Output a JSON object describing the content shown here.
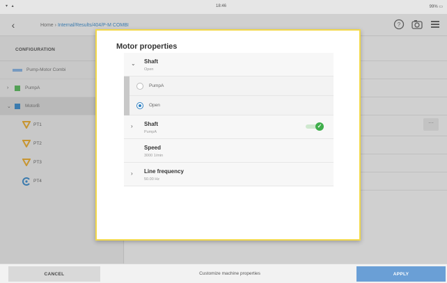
{
  "status": {
    "time": "18:46",
    "battery": "99%"
  },
  "header": {
    "home": "Home",
    "sep1": "›",
    "path": "Internal/Results/404/P-M COMBI"
  },
  "sidebar": {
    "title": "CONFIGURATION",
    "machine": "Pump-Motor Combi",
    "pump": "PumpA",
    "motor": "MotorB",
    "points": [
      "PT1",
      "PT2",
      "PT3",
      "PT4"
    ]
  },
  "dialog": {
    "title": "Motor properties",
    "shaft1": {
      "label": "Shaft",
      "value": "Open"
    },
    "options": [
      "PumpA",
      "Open"
    ],
    "shaft2": {
      "label": "Shaft",
      "value": "PumpA"
    },
    "speed": {
      "label": "Speed",
      "value": "3000 1/min"
    },
    "line": {
      "label": "Line frequency",
      "value": "50.00 Hz"
    }
  },
  "bottom": {
    "cancel": "CANCEL",
    "title": "Customize machine properties",
    "apply": "APPLY"
  },
  "colors": {
    "accent": "#2d7fc1",
    "apply": "#6a9fd6",
    "dialog_border": "#f2d84a",
    "pump_icon": "#4caf50",
    "motor_icon": "#2d7fc1",
    "point_icon": "#e0a020"
  },
  "icons": [
    "back-arrow-icon",
    "help-icon",
    "camera-icon",
    "menu-icon",
    "machine-icon",
    "pump-icon",
    "motor-icon",
    "measurement-point-icon",
    "sensor-icon",
    "check-icon"
  ]
}
